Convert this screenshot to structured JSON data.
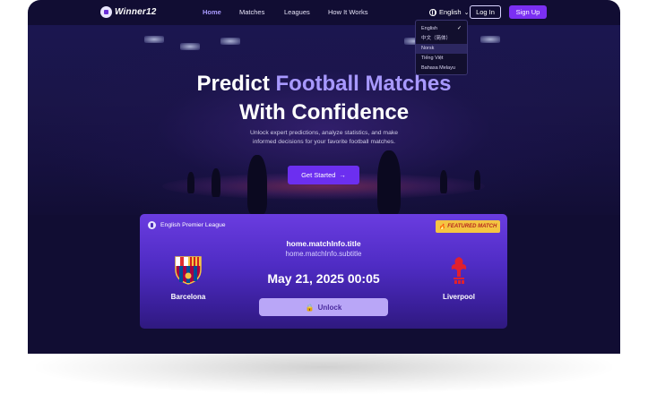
{
  "app": {
    "logo_text": "Winner12"
  },
  "nav": {
    "links": [
      {
        "label": "Home",
        "active": true
      },
      {
        "label": "Matches",
        "active": false
      },
      {
        "label": "Leagues",
        "active": false
      },
      {
        "label": "How It Works",
        "active": false
      }
    ],
    "language_label": "English",
    "login_label": "Log In",
    "signup_label": "Sign Up"
  },
  "language_menu": {
    "options": [
      "English",
      "中文（简体）",
      "Norsk",
      "Tiếng Việt",
      "Bahasa Melayu"
    ],
    "selected": "English",
    "hovered": "Norsk"
  },
  "hero": {
    "title_line1_plain": "Predict ",
    "title_line1_accent": "Football Matches",
    "title_line2": "With Confidence",
    "subtitle": "Unlock expert predictions, analyze statistics, and make informed decisions for your favorite football matches.",
    "cta_label": "Get Started"
  },
  "featured_match": {
    "league": "English Premier League",
    "badge": "FEATURED MATCH",
    "title": "home.matchInfo.title",
    "subtitle": "home.matchInfo.subtitle",
    "datetime": "May 21, 2025 00:05",
    "home_team": "Barcelona",
    "away_team": "Liverpool",
    "unlock_label": "Unlock"
  },
  "colors": {
    "page_bg": "#110d33",
    "accent": "#7b2ff2",
    "accent_text": "#a899ff",
    "badge_bg": "#f4c542"
  },
  "icons": [
    "logo-ball-icon",
    "globe-icon",
    "chevron-down-icon",
    "check-icon",
    "arrow-right-icon",
    "league-icon",
    "fire-icon",
    "barcelona-crest-icon",
    "liverpool-crest-icon",
    "lock-icon"
  ]
}
